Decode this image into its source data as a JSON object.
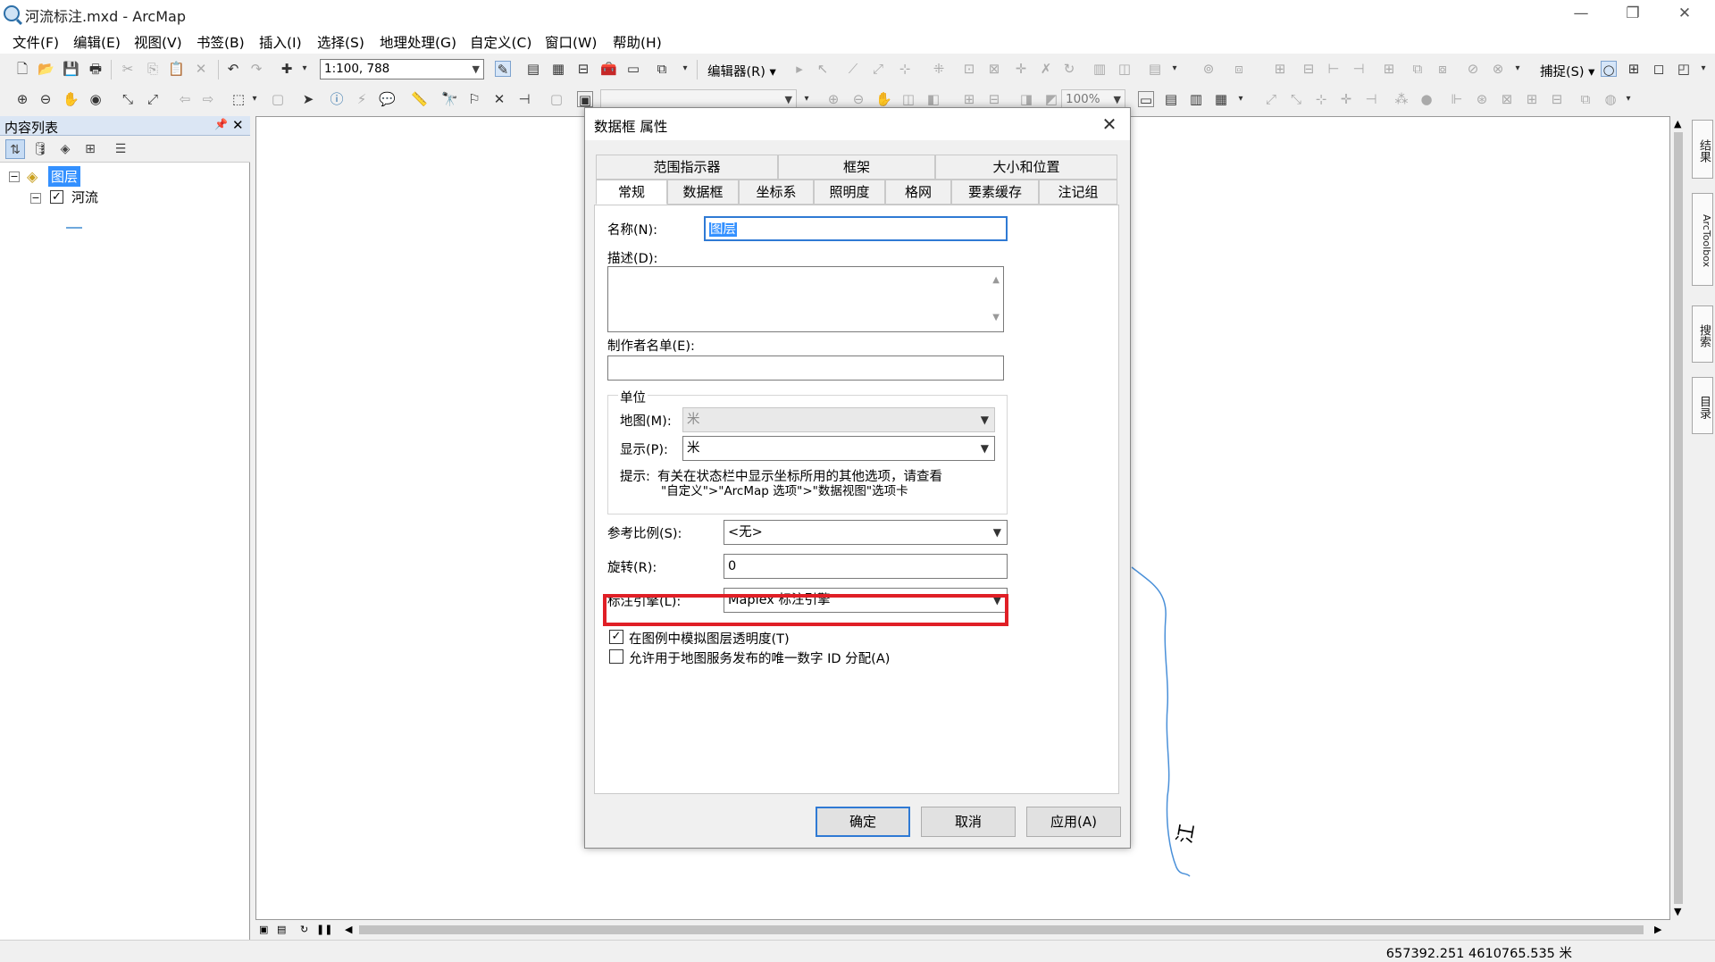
{
  "window": {
    "title": "河流标注.mxd - ArcMap",
    "min": "—",
    "max": "❐",
    "close": "✕"
  },
  "menu": [
    "文件(F)",
    "编辑(E)",
    "视图(V)",
    "书签(B)",
    "插入(I)",
    "选择(S)",
    "地理处理(G)",
    "自定义(C)",
    "窗口(W)",
    "帮助(H)"
  ],
  "toolbar": {
    "scale": "1:100, 788",
    "editor": "编辑器(R)",
    "snapping": "捕捉(S)",
    "zoom": "100%"
  },
  "toc": {
    "title": "内容列表",
    "pin": "📌",
    "close": "✕",
    "layers_group": "图层",
    "layer": "河流"
  },
  "status": {
    "coords": "657392.251  4610765.535 米"
  },
  "side_tabs": [
    "结果",
    "ArcToolbox",
    "搜索",
    "目录"
  ],
  "map": {
    "river_label": "江"
  },
  "dialog": {
    "title": "数据框 属性",
    "close": "✕",
    "tabs_row1": [
      "范围指示器",
      "框架",
      "大小和位置"
    ],
    "tabs_row2": [
      "常规",
      "数据框",
      "坐标系",
      "照明度",
      "格网",
      "要素缓存",
      "注记组"
    ],
    "name_label": "名称(N):",
    "name_value": "图层",
    "desc_label": "描述(D):",
    "credits_label": "制作者名单(E):",
    "units_group": "单位",
    "map_units_label": "地图(M):",
    "map_units_value": "米",
    "display_units_label": "显示(P):",
    "display_units_value": "米",
    "hint_label": "提示:",
    "hint_line1": "有关在状态栏中显示坐标所用的其他选项，请查看",
    "hint_line2": "\"自定义\">\"ArcMap 选项\">\"数据视图\"选项卡",
    "ref_scale_label": "参考比例(S):",
    "ref_scale_value": "<无>",
    "rotation_label": "旋转(R):",
    "rotation_value": "0",
    "label_engine_label": "标注引擎(L):",
    "label_engine_value": "Maplex 标注引擎",
    "chk1_label": "在图例中模拟图层透明度(T)",
    "chk1_checked": "✓",
    "chk2_label": "允许用于地图服务发布的唯一数字 ID 分配(A)",
    "ok": "确定",
    "cancel": "取消",
    "apply": "应用(A)"
  }
}
